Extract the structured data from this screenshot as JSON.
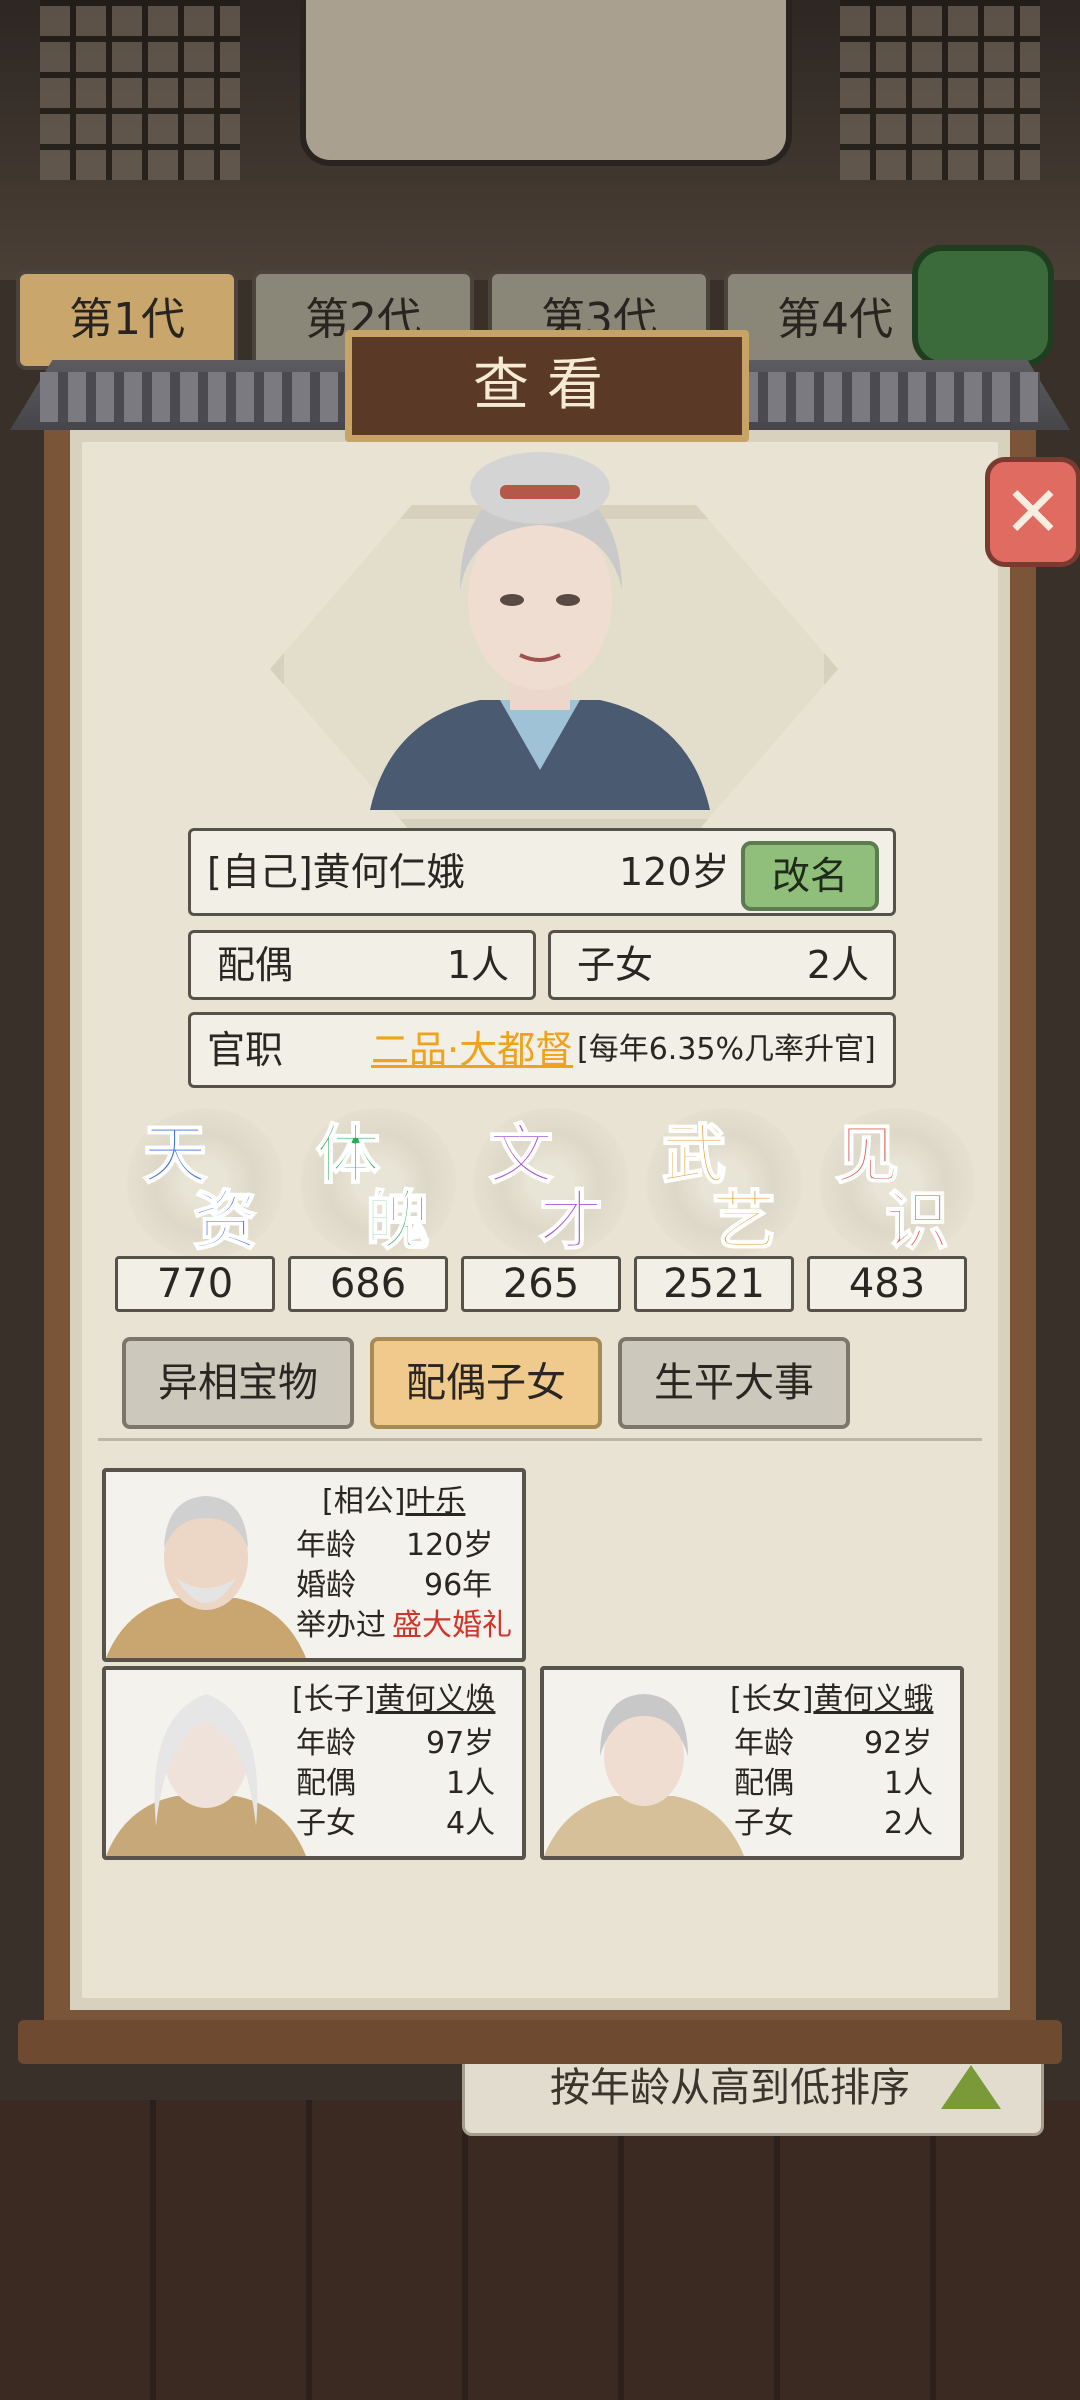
{
  "generation_tabs": [
    "第1代",
    "第2代",
    "第3代",
    "第4代"
  ],
  "panel": {
    "title": "查看",
    "close": "✕"
  },
  "profile": {
    "name": "[自己]黄何仁娥",
    "age": "120岁",
    "rename_label": "改名",
    "spouse_label": "配偶",
    "spouse_count": "1人",
    "children_label": "子女",
    "children_count": "2人",
    "office_label": "官职",
    "office_value": "二品·大都督",
    "office_note": "[每年6.35%几率升官]"
  },
  "stats": [
    {
      "chars": [
        "天",
        "资"
      ],
      "value": "770",
      "color": "#3a6fe0"
    },
    {
      "chars": [
        "体",
        "魄"
      ],
      "value": "686",
      "color": "#2fa85a"
    },
    {
      "chars": [
        "文",
        "才"
      ],
      "value": "265",
      "color": "#a452d8"
    },
    {
      "chars": [
        "武",
        "艺"
      ],
      "value": "2521",
      "color": "#e0a030"
    },
    {
      "chars": [
        "见",
        "识"
      ],
      "value": "483",
      "color": "#e0605a"
    }
  ],
  "tabs": [
    "异相宝物",
    "配偶子女",
    "生平大事"
  ],
  "family": {
    "spouse": {
      "role": "[相公]",
      "name": "叶乐",
      "age_label": "年龄",
      "age": "120岁",
      "marriage_label": "婚龄",
      "marriage": "96年",
      "wedding_prefix": "举办过",
      "wedding": "盛大婚礼"
    },
    "son": {
      "role": "[长子]",
      "name": "黄何义焕",
      "age_label": "年龄",
      "age": "97岁",
      "spouse_label": "配偶",
      "spouse": "1人",
      "children_label": "子女",
      "children": "4人"
    },
    "daughter": {
      "role": "[长女]",
      "name": "黄何义蛾",
      "age_label": "年龄",
      "age": "92岁",
      "spouse_label": "配偶",
      "spouse": "1人",
      "children_label": "子女",
      "children": "2人"
    }
  },
  "sort_label": "按年龄从高到低排序"
}
